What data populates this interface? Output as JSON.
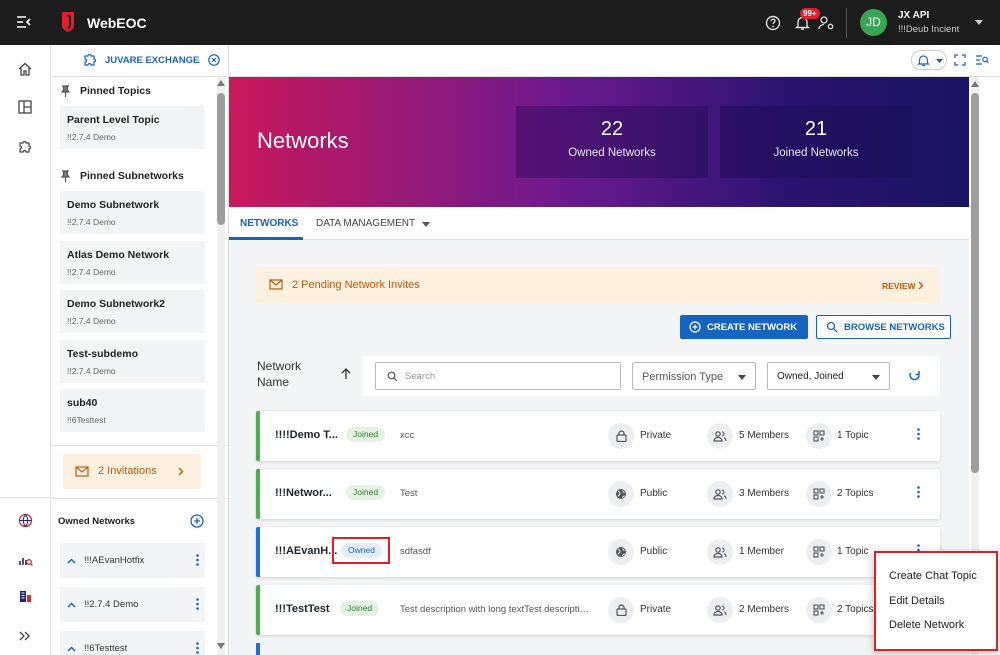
{
  "app": {
    "title": "WebEOC"
  },
  "topbar": {
    "notification_count": "99+",
    "user_initials": "JD",
    "user_name": "JX API",
    "user_role": "!!!Deub Incient"
  },
  "tab": {
    "label": "JUVARE EXCHANGE"
  },
  "sidebar": {
    "pinned_topics_title": "Pinned Topics",
    "pinned_topics": [
      {
        "name": "Parent Level Topic",
        "sub": "!!2.7.4 Demo"
      }
    ],
    "pinned_subnetworks_title": "Pinned Subnetworks",
    "pinned_subnetworks": [
      {
        "name": "Demo Subnetwork",
        "sub": "!!2.7.4 Demo"
      },
      {
        "name": "Atlas Demo Network",
        "sub": "!!2.7.4 Demo"
      },
      {
        "name": "Demo Subnetwork2",
        "sub": "!!2.7.4 Demo"
      },
      {
        "name": "Test-subdemo",
        "sub": "!!2.7.4 Demo"
      },
      {
        "name": "sub40",
        "sub": "!!6Testtest"
      }
    ],
    "invitations_label": "2 Invitations",
    "owned_networks_title": "Owned Networks",
    "owned_networks": [
      "!!!AEvanHotfix",
      "!!2.7.4 Demo",
      "!!6Testtest"
    ]
  },
  "hero": {
    "title": "Networks",
    "owned_count": "22",
    "owned_label": "Owned Networks",
    "joined_count": "21",
    "joined_label": "Joined Networks"
  },
  "tabs": {
    "networks": "NETWORKS",
    "data_management": "DATA MANAGEMENT"
  },
  "pending": {
    "text": "2 Pending Network Invites",
    "review": "REVIEW"
  },
  "actions": {
    "create": "CREATE NETWORK",
    "browse": "BROWSE NETWORKS"
  },
  "filters": {
    "column_label": "Network Name",
    "search_placeholder": "Search",
    "permission_type": "Permission Type",
    "ownership": "Owned, Joined"
  },
  "rows": [
    {
      "name": "!!!!Demo T...",
      "badge": "Joined",
      "desc": "xcc",
      "privacy": "Private",
      "members": "5 Members",
      "topics": "1 Topic"
    },
    {
      "name": "!!!Networ...",
      "badge": "Joined",
      "desc": "Test",
      "privacy": "Public",
      "members": "3 Members",
      "topics": "2 Topics"
    },
    {
      "name": "!!!AEvanH...",
      "badge": "Owned",
      "desc": "sdfasdf",
      "privacy": "Public",
      "members": "1 Member",
      "topics": "1 Topic"
    },
    {
      "name": "!!!TestTest",
      "badge": "Joined",
      "desc": "Test description with long textTest description with long text",
      "privacy": "Private",
      "members": "2 Members",
      "topics": "2 Topics"
    }
  ],
  "context_menu": {
    "items": [
      "Create Chat Topic",
      "Edit Details",
      "Delete Network"
    ]
  },
  "colors": {
    "accent": "#1565c0",
    "joined_border": "#4caf50",
    "owned_border": "#1e6fd9",
    "highlight_box": "#e02020",
    "pending_bg": "#fdf0df",
    "pending_text": "#c25a0f"
  }
}
